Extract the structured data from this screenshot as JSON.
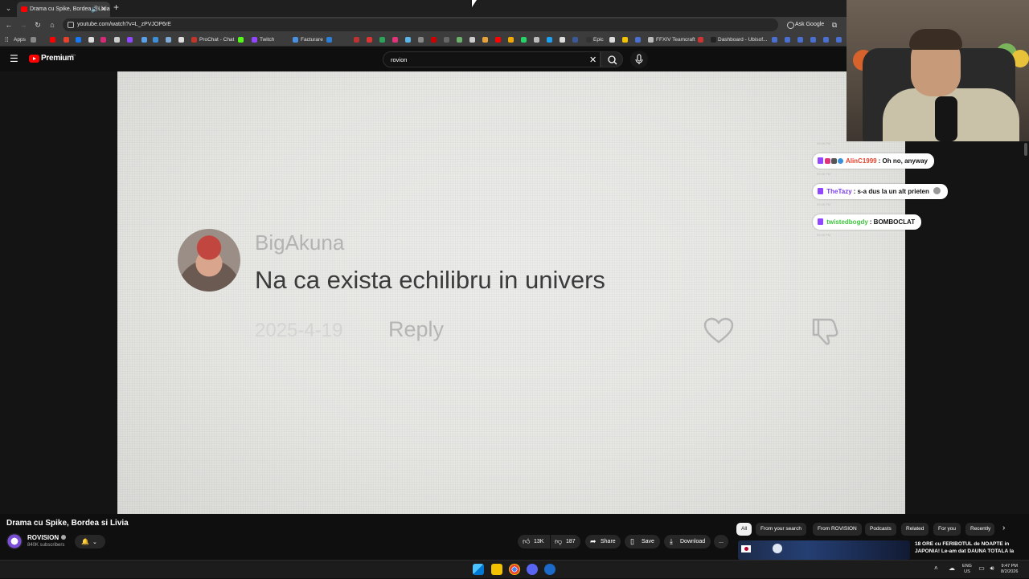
{
  "browser": {
    "tab_title": "Drama cu Spike, Bordea si Livia",
    "url": "youtube.com/watch?v=L_zPVJOP6rE",
    "ask_google": "Ask Google",
    "bookmarks": {
      "apps": "Apps",
      "prochat": "ProChat - Chat",
      "twitch": "Twitch",
      "facturare": "Facturare",
      "epic": "Epic",
      "ffxiv": "FFXIV Teamcraft",
      "dashboard": "Dashboard - Ubisof..."
    }
  },
  "youtube": {
    "brand": "Premium",
    "region": "RO",
    "search_query": "rovion"
  },
  "video_frame": {
    "author": "BigAkuna",
    "comment": "Na ca exista echilibru in univers",
    "date": "2025-4-19",
    "reply": "Reply"
  },
  "chat": {
    "messages": [
      {
        "time": "09:46 PM",
        "user": "AlinC1999",
        "text": ": Oh no, anyway",
        "user_color": "#e6412d"
      },
      {
        "time": "09:46 PM",
        "user": "TheTazy",
        "text": ": s-a dus la un alt prieten",
        "user_color": "#7b3fe4"
      },
      {
        "time": "09:46 PM",
        "user": "twistedbogdy",
        "text": ": BOMBOCLAT",
        "user_color": "#3fc43f"
      }
    ],
    "trailing_time": "09:46 PM"
  },
  "video_info": {
    "title": "Drama cu Spike, Bordea si Livia",
    "channel": "ROVISION",
    "subscribers": "840K subscribers",
    "likes": "13K",
    "dislikes": "187",
    "share": "Share",
    "save": "Save",
    "download": "Download",
    "more": "..."
  },
  "chips": [
    "All",
    "From your search",
    "From ROVISION",
    "Podcasts",
    "Related",
    "For you",
    "Recently"
  ],
  "related": {
    "title": "18 ORE cu FERIBOTUL de NOAPTE in JAPONIA! Le-am dat DAUNA TOTALA la"
  },
  "taskbar": {
    "lang": "ENG",
    "lang_region": "US",
    "time": "9:47 PM",
    "date": "8/2/2026"
  },
  "colors": {
    "youtube_red": "#ff0000",
    "twitch_purple": "#9146ff"
  }
}
